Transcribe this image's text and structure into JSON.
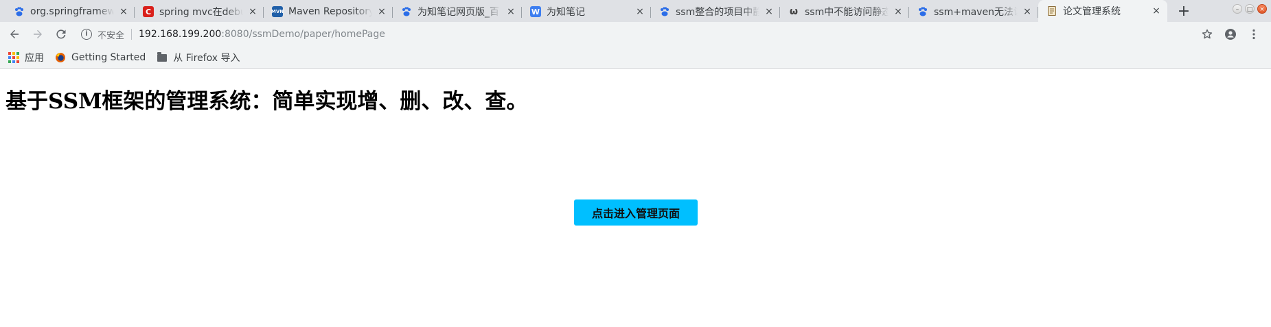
{
  "browser": {
    "tabs": [
      {
        "title": "org.springframew",
        "icon": "baidu-paw-icon",
        "active": false
      },
      {
        "title": "spring mvc在debu",
        "icon": "csdn-icon",
        "active": false
      },
      {
        "title": "Maven Repository",
        "icon": "mvn-icon",
        "active": false
      },
      {
        "title": "为知笔记网页版_百",
        "icon": "baidu-paw-icon",
        "active": false
      },
      {
        "title": "为知笔记",
        "icon": "wiz-icon",
        "active": false
      },
      {
        "title": "ssm整合的项目中静",
        "icon": "baidu-paw-icon",
        "active": false
      },
      {
        "title": "ssm中不能访问静态",
        "icon": "omega-icon",
        "active": false
      },
      {
        "title": "ssm+maven无法访",
        "icon": "baidu-paw-icon",
        "active": false
      },
      {
        "title": "论文管理系统",
        "icon": "document-icon",
        "active": true
      }
    ],
    "close_glyph": "×",
    "new_tab_glyph": "+",
    "address_bar": {
      "security_label": "不安全",
      "url_host": "192.168.199.200",
      "url_path": ":8080/ssmDemo/paper/homePage"
    },
    "bookmarks": [
      {
        "label": "应用",
        "icon": "apps-grid-icon"
      },
      {
        "label": "Getting Started",
        "icon": "firefox-icon"
      },
      {
        "label": "从 Firefox 导入",
        "icon": "folder-icon"
      }
    ]
  },
  "page": {
    "heading": "基于SSM框架的管理系统：简单实现增、删、改、查。",
    "enter_button_label": "点击进入管理页面"
  },
  "colors": {
    "button_bg": "#00bfff",
    "tabstrip_bg": "#dfe1e5",
    "toolbar_bg": "#f1f3f4"
  }
}
